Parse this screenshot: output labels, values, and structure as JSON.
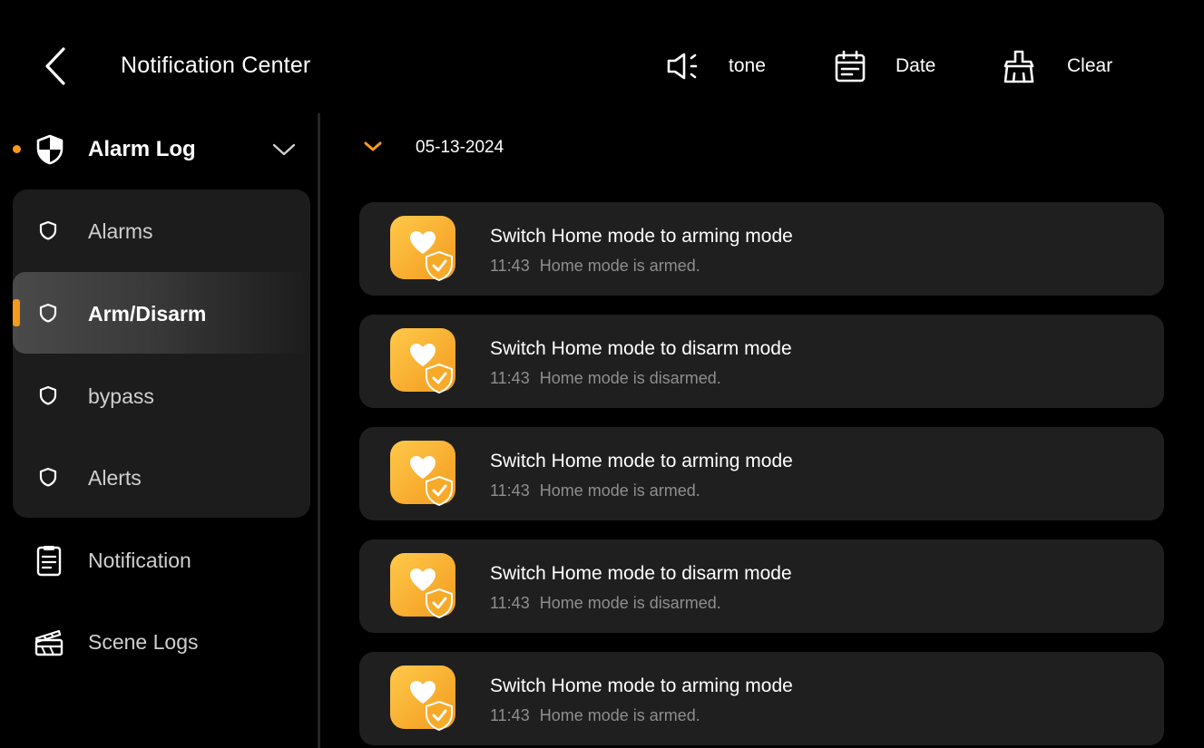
{
  "header": {
    "title": "Notification Center",
    "actions": [
      {
        "id": "tone",
        "label": "tone",
        "icon": "speaker-icon"
      },
      {
        "id": "date",
        "label": "Date",
        "icon": "calendar-icon"
      },
      {
        "id": "clear",
        "label": "Clear",
        "icon": "broom-icon"
      }
    ]
  },
  "sidebar": {
    "group": {
      "label": "Alarm Log",
      "icon": "shield-icon",
      "expanded": true
    },
    "submenu": [
      {
        "label": "Alarms",
        "active": false
      },
      {
        "label": "Arm/Disarm",
        "active": true
      },
      {
        "label": "bypass",
        "active": false
      },
      {
        "label": "Alerts",
        "active": false
      }
    ],
    "items": [
      {
        "label": "Notification",
        "icon": "clipboard-icon"
      },
      {
        "label": "Scene Logs",
        "icon": "clapperboard-icon"
      }
    ]
  },
  "main": {
    "date_label": "05-13-2024",
    "cards": [
      {
        "title": "Switch Home mode to arming mode",
        "time": "11:43",
        "detail": "Home mode is armed."
      },
      {
        "title": "Switch Home mode to disarm mode",
        "time": "11:43",
        "detail": "Home mode is disarmed."
      },
      {
        "title": "Switch Home mode to arming mode",
        "time": "11:43",
        "detail": "Home mode is armed."
      },
      {
        "title": "Switch Home mode to disarm mode",
        "time": "11:43",
        "detail": "Home mode is disarmed."
      },
      {
        "title": "Switch Home mode to arming mode",
        "time": "11:43",
        "detail": "Home mode is armed."
      }
    ]
  },
  "colors": {
    "background": "#000000",
    "accent": "#f59a1c",
    "panel": "#1c1c1c",
    "card": "#1f1f1f",
    "muted_text": "#8e8e8e"
  }
}
